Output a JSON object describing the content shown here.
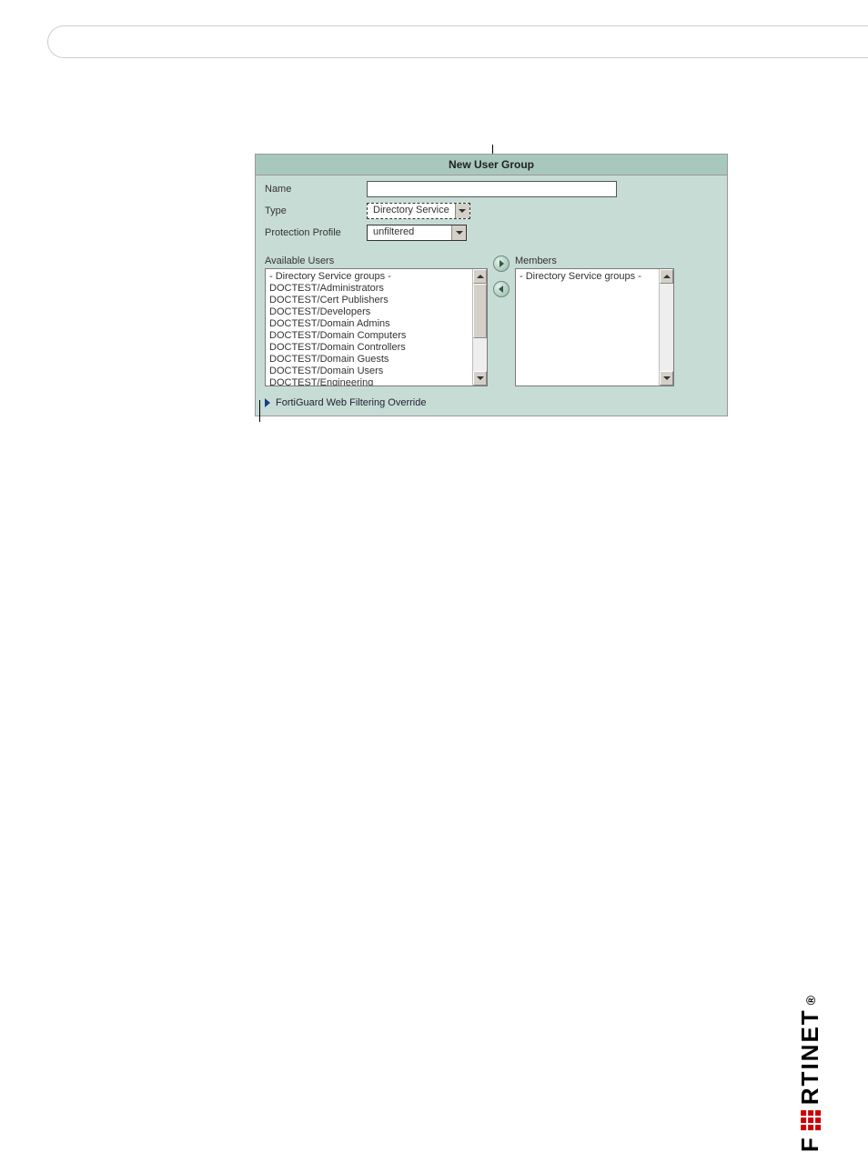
{
  "dialog": {
    "title": "New User Group",
    "fields": {
      "name_label": "Name",
      "name_value": "",
      "type_label": "Type",
      "type_value": "Directory Service",
      "protection_label": "Protection Profile",
      "protection_value": "unfiltered"
    },
    "available_label": "Available Users",
    "members_label": "Members",
    "available_items": [
      "- Directory Service groups -",
      "DOCTEST/Administrators",
      "DOCTEST/Cert Publishers",
      "DOCTEST/Developers",
      "DOCTEST/Domain Admins",
      "DOCTEST/Domain Computers",
      "DOCTEST/Domain Controllers",
      "DOCTEST/Domain Guests",
      "DOCTEST/Domain Users",
      "DOCTEST/Engineering"
    ],
    "members_items": [
      "- Directory Service groups -"
    ],
    "expand_label": "FortiGuard Web Filtering Override"
  },
  "brand": "F    RTINET"
}
